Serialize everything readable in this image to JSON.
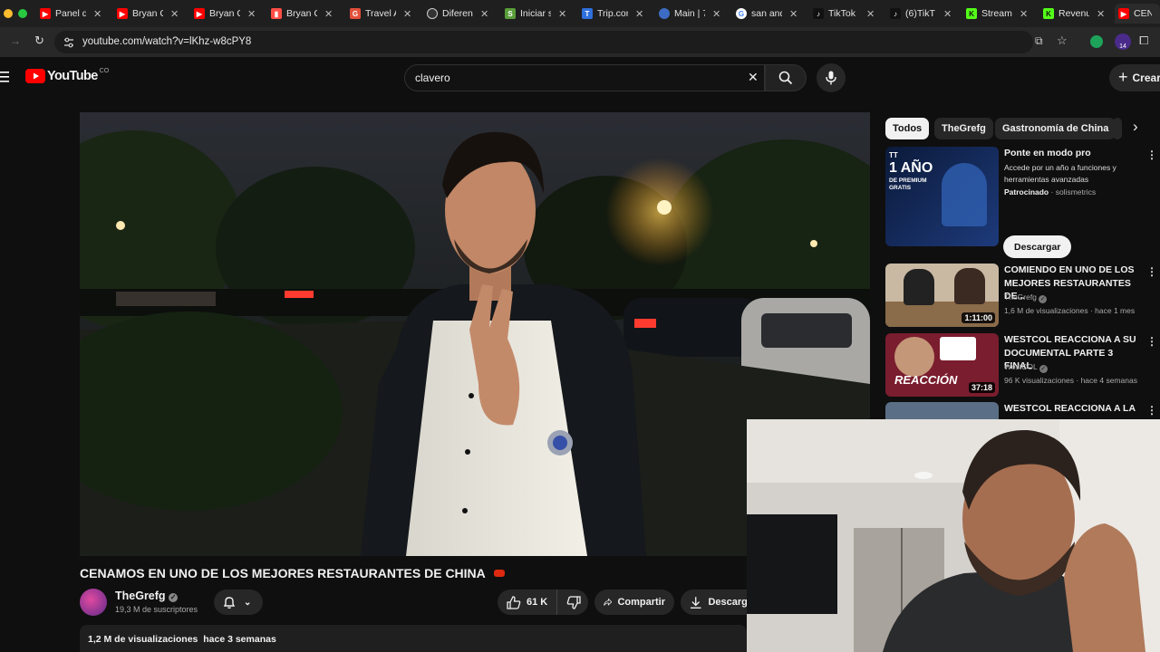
{
  "browser": {
    "tabs": [
      {
        "label": "Panel d",
        "icon": "youtube-icon",
        "color": "#ff0000"
      },
      {
        "label": "Bryan C",
        "icon": "youtube-icon",
        "color": "#ff0000"
      },
      {
        "label": "Bryan C",
        "icon": "youtube-icon",
        "color": "#ff0000"
      },
      {
        "label": "Bryan C",
        "icon": "analytics-icon",
        "color": "#ff4e45"
      },
      {
        "label": "Travel A",
        "icon": "grammarly-icon",
        "color": "#e34f3a"
      },
      {
        "label": "Diferenc",
        "icon": "openai-icon",
        "color": "#cfcfcf"
      },
      {
        "label": "Iniciar s",
        "icon": "shopify-icon",
        "color": "#5a9e3a"
      },
      {
        "label": "Trip.com",
        "icon": "trip-icon",
        "color": "#2f6fde"
      },
      {
        "label": "Main | 7",
        "icon": "brain-icon",
        "color": "#3d6cc4"
      },
      {
        "label": "san and",
        "icon": "google-icon",
        "color": "#ffffff"
      },
      {
        "label": "TikTok",
        "icon": "tiktok-icon",
        "color": "#111111"
      },
      {
        "label": "(6)TikT",
        "icon": "tiktok-icon",
        "color": "#111111"
      },
      {
        "label": "Stream",
        "icon": "kick-icon",
        "color": "#53fc18"
      },
      {
        "label": "Revenu",
        "icon": "kick-icon",
        "color": "#53fc18"
      },
      {
        "label": "CEN",
        "icon": "youtube-icon",
        "color": "#ff0000"
      }
    ],
    "url": "youtube.com/watch?v=lKhz-w8cPY8"
  },
  "header": {
    "logo_text": "YouTube",
    "country": "CO",
    "search_value": "clavero",
    "create_label": "Crear",
    "avatar_badge": "14"
  },
  "chips": [
    "Todos",
    "TheGrefg",
    "Gastronomía de China"
  ],
  "recommendations": [
    {
      "title": "Ponte en modo pro",
      "desc": "Accede por un año a funciones y herramientas avanzadas",
      "sponsored": "Patrocinado",
      "advertiser": "solismetrics",
      "cta": "Descargar",
      "thumb_text": "1 AÑO",
      "thumb_sub": "DE PREMIUM GRATIS"
    },
    {
      "title": "COMIENDO EN UNO DE LOS MEJORES RESTAURANTES DE...",
      "channel": "TheGrefg",
      "meta": "1,6 M de visualizaciones · hace 1 mes",
      "duration": "1:11:00"
    },
    {
      "title": "WESTCOL REACCIONA A SU DOCUMENTAL PARTE 3 FINAL",
      "channel": "WestCOL",
      "meta": "96 K visualizaciones · hace 4 semanas",
      "duration": "37:18",
      "thumb_text": "REACCIÓN"
    },
    {
      "title": "WESTCOL REACCIONA A LA"
    }
  ],
  "video": {
    "title": "CENAMOS EN UNO DE LOS MEJORES RESTAURANTES DE CHINA",
    "channel": "TheGrefg",
    "subscribers": "19,3 M de suscriptores",
    "likes": "61 K",
    "share_label": "Compartir",
    "download_label": "Descarga",
    "views": "1,2 M de visualizaciones",
    "age": "hace 3 semanas"
  },
  "colors": {
    "accent": "#ff0000",
    "background": "#0f0f0f",
    "chip_selected": "#f1f1f1"
  }
}
